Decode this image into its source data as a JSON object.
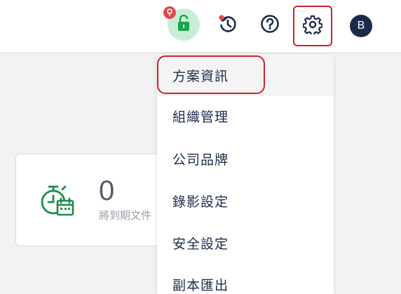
{
  "topbar": {
    "lock_icon": "lock-icon",
    "badge_icon": "exclamation-icon",
    "history_icon": "history-icon",
    "help_icon": "help-circle-icon",
    "settings_icon": "gear-icon",
    "avatar_initial": "B",
    "colors": {
      "lock_bg": "#c9eed6",
      "lock": "#1aa34a",
      "badge": "#e04a4a",
      "highlight": "#d0202e",
      "avatar_bg": "#1c2b4a"
    }
  },
  "card": {
    "icon": "timer-calendar-icon",
    "count": "0",
    "label": "將到期文件",
    "icon_color": "#1d8a4e"
  },
  "menu": {
    "items": [
      {
        "label": "方案資訊"
      },
      {
        "label": "組織管理"
      },
      {
        "label": "公司品牌"
      },
      {
        "label": "錄影設定"
      },
      {
        "label": "安全設定"
      },
      {
        "label": "副本匯出"
      }
    ]
  }
}
